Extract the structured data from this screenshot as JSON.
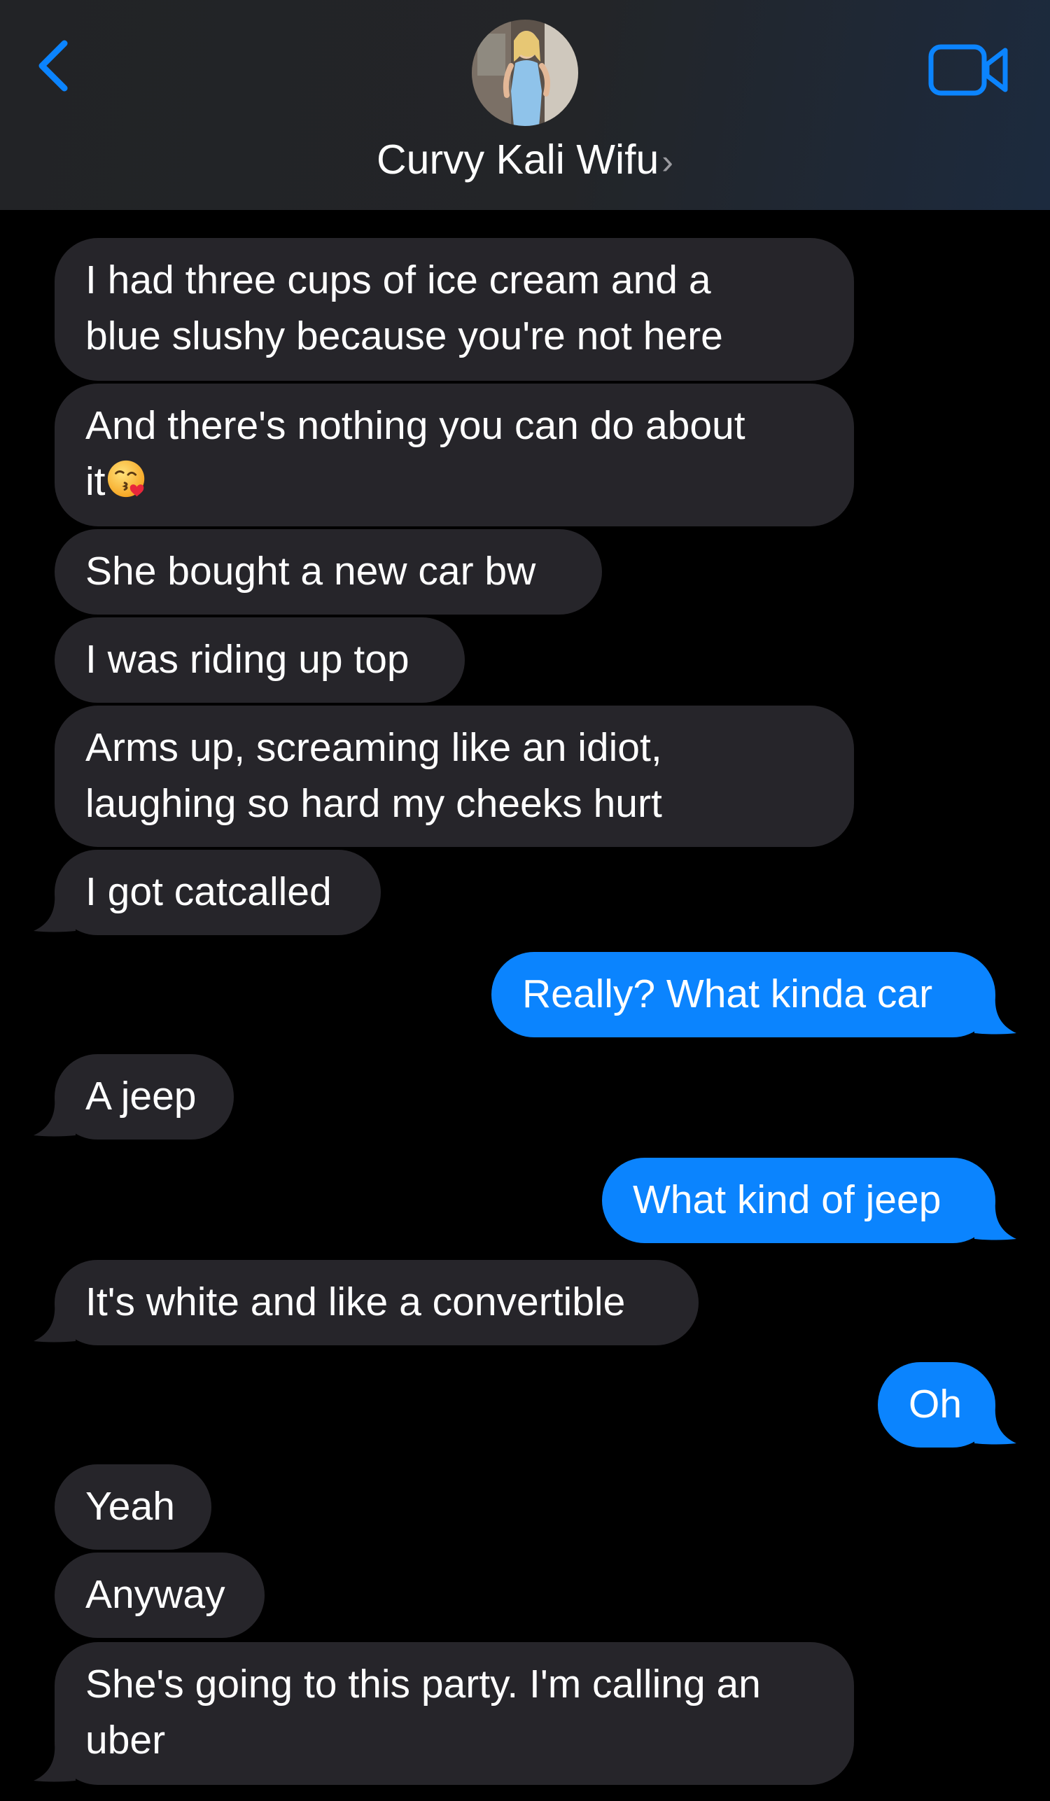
{
  "header": {
    "contact_name": "Curvy Kali Wifu",
    "chevron": "›",
    "back_icon": "chevron-left-icon",
    "video_icon": "video-camera-icon",
    "accent_color": "#0b84fe"
  },
  "colors": {
    "incoming_bubble": "#26252a",
    "outgoing_bubble": "#0b84fe",
    "background": "#000000"
  },
  "messages": [
    {
      "sender": "them",
      "lines": [
        "I had three cups of ice cream and a",
        "blue slushy because you're not here"
      ]
    },
    {
      "sender": "them",
      "lines": [
        "And there's nothing you can do about",
        "it"
      ],
      "emoji": "face-blowing-kiss"
    },
    {
      "sender": "them",
      "lines": [
        "She bought a new car bw"
      ]
    },
    {
      "sender": "them",
      "lines": [
        "I was riding up top"
      ]
    },
    {
      "sender": "them",
      "lines": [
        "Arms up, screaming like an idiot,",
        "laughing so hard my cheeks hurt"
      ]
    },
    {
      "sender": "them",
      "lines": [
        "I got catcalled"
      ]
    },
    {
      "sender": "me",
      "lines": [
        "Really? What kinda car"
      ]
    },
    {
      "sender": "them",
      "lines": [
        "A jeep"
      ]
    },
    {
      "sender": "me",
      "lines": [
        "What kind of jeep"
      ]
    },
    {
      "sender": "them",
      "lines": [
        "It's white and like a convertible"
      ]
    },
    {
      "sender": "me",
      "lines": [
        "Oh"
      ]
    },
    {
      "sender": "them",
      "lines": [
        "Yeah"
      ]
    },
    {
      "sender": "them",
      "lines": [
        "Anyway"
      ]
    },
    {
      "sender": "them",
      "lines": [
        "She's going to this party. I'm calling an",
        "uber"
      ]
    }
  ]
}
